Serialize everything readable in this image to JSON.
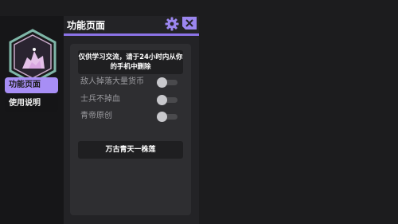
{
  "sidebar": {
    "items": [
      {
        "label": "功能页面",
        "active": true
      },
      {
        "label": "使用说明",
        "active": false
      }
    ]
  },
  "panel": {
    "title": "功能页面",
    "icons": {
      "settings": "gear-icon",
      "close": "close-icon"
    },
    "accent_color": "#8b73e6",
    "notice": "仅供学习交流，请于24小时内从你的手机中删除",
    "toggles": [
      {
        "label": "敌人掉落大量货币",
        "on": false
      },
      {
        "label": "士兵不掉血",
        "on": false
      },
      {
        "label": "青帝原创",
        "on": false
      }
    ],
    "action_button": "万古青天一株莲"
  }
}
